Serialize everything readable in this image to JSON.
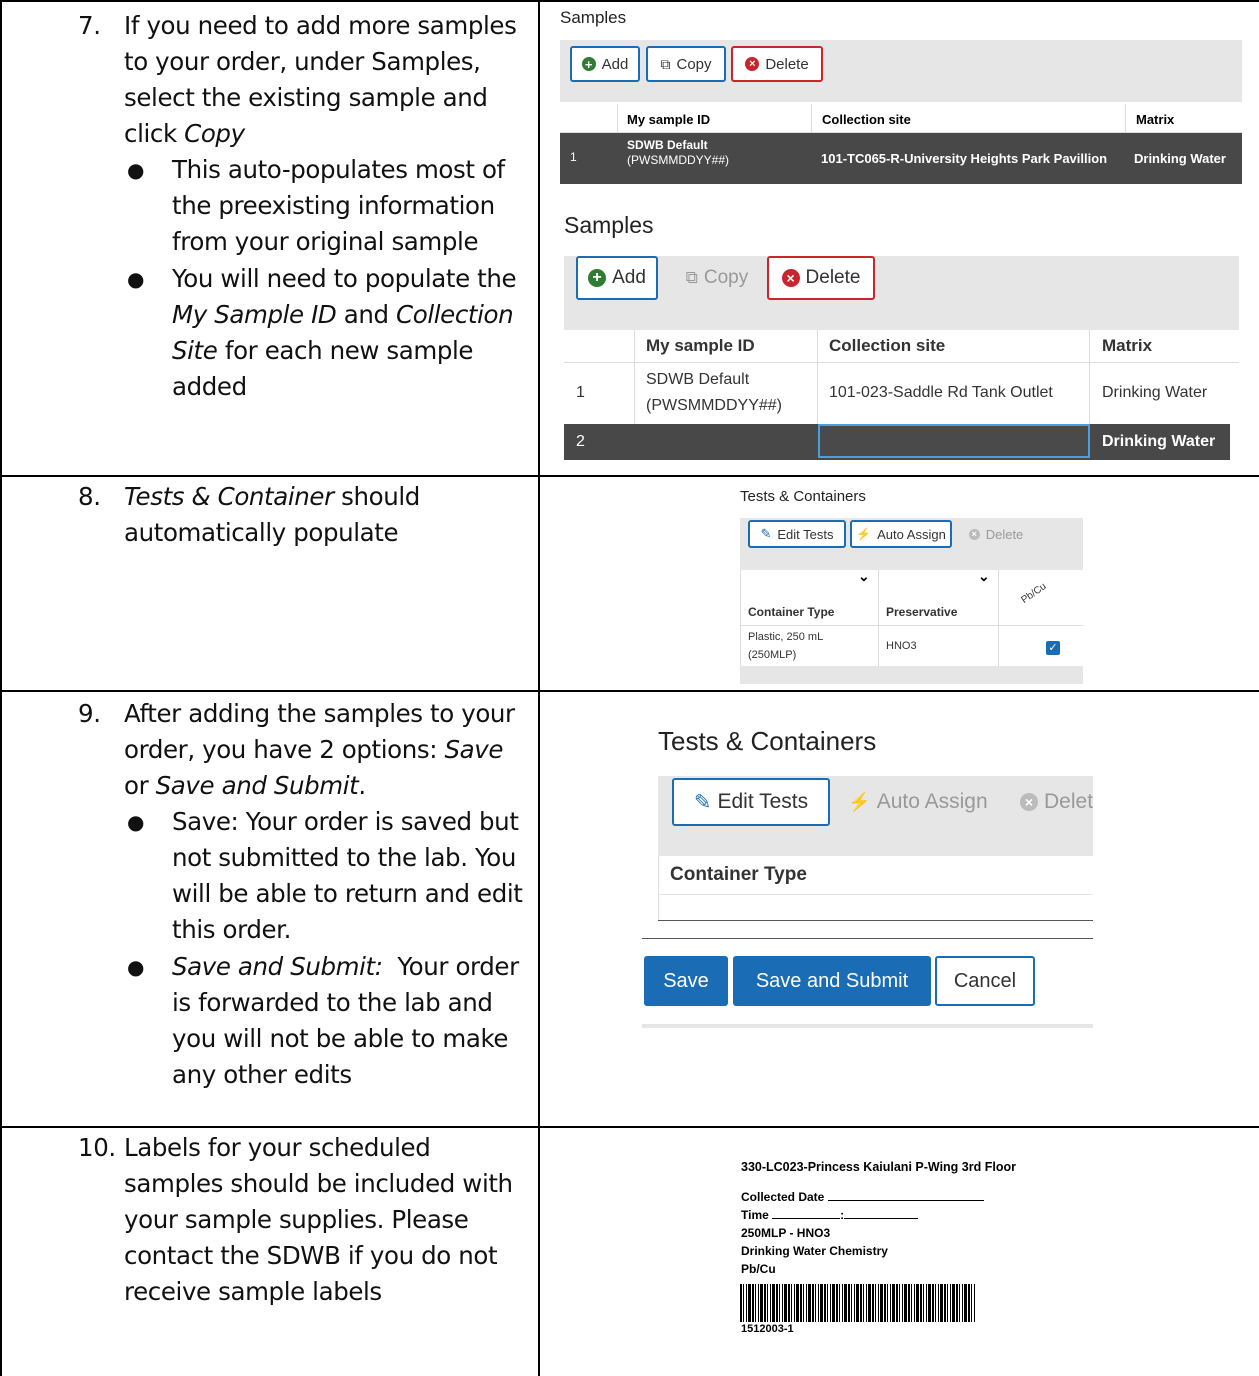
{
  "steps": {
    "s7": {
      "number": "7.",
      "l1": "If you need to add more samples",
      "l2": "to your order, under Samples,",
      "l3": "select the existing sample and",
      "l4a": "click ",
      "l4b": "Copy",
      "b1": "This auto-populates most of",
      "b1b": "the preexisting information",
      "b1c": "from your original sample",
      "b2": "You will need to populate the",
      "b2b1": "My Sample ID",
      "b2b2": " and ",
      "b2b3": "Collection",
      "b2c1": "Site",
      "b2c2": " for each new sample",
      "b2d": "added"
    },
    "s8": {
      "number": "8.",
      "l1a": "Tests & Container",
      "l1b": " should",
      "l2": "automatically populate"
    },
    "s9": {
      "number": "9.",
      "l1": "After adding the samples to your",
      "l2a": "order, you have 2 options: ",
      "l2b": "Save",
      "l3a": "or ",
      "l3b": "Save and Submit",
      "l3c": ".",
      "b1": "Save: Your order is saved but",
      "b1b": "not submitted to the lab. You",
      "b1c": "will be able to return and edit",
      "b1d": "this order.",
      "b2a": "Save and Submit:",
      "b2b": "  Your order",
      "b2c": "is forwarded to the lab and",
      "b2d": "you will not be able to make",
      "b2e": "any other edits"
    },
    "s10": {
      "number": "10.",
      "l1": "Labels for your scheduled",
      "l2": "samples should be included with",
      "l3": "your sample supplies. Please",
      "l4": "contact the SDWB if you do not",
      "l5": "receive sample labels"
    }
  },
  "shot1": {
    "title": "Samples",
    "add": "Add",
    "copy": "Copy",
    "delete": "Delete",
    "headers": [
      "My sample ID",
      "Collection site",
      "Matrix"
    ],
    "row": {
      "num": "1",
      "id1": "SDWB Default",
      "id2": "(PWSMMDDYY##)",
      "site": "101-TC065-R-University Heights Park Pavillion",
      "matrix": "Drinking Water"
    }
  },
  "shot2": {
    "title": "Samples",
    "add": "Add",
    "copy": "Copy",
    "delete": "Delete",
    "headers": [
      "My sample ID",
      "Collection site",
      "Matrix"
    ],
    "row1": {
      "num": "1",
      "id1": "SDWB Default",
      "id2": "(PWSMMDDYY##)",
      "site": "101-023-Saddle Rd Tank Outlet",
      "matrix": "Drinking Water"
    },
    "row2": {
      "num": "2",
      "id": "",
      "site": "",
      "matrix": "Drinking Water"
    }
  },
  "shot3": {
    "title": "Tests & Containers",
    "edit_tests": "Edit Tests",
    "auto_assign": "Auto Assign",
    "delete": "Delete",
    "headers": [
      "Container Type",
      "Preservative",
      "Pb/Cu"
    ],
    "row": {
      "type1": "Plastic, 250 mL",
      "type2": "(250MLP)",
      "preservative": "HNO3",
      "checked": true
    }
  },
  "shot4": {
    "title": "Tests & Containers",
    "edit_tests": "Edit Tests",
    "auto_assign": "Auto Assign",
    "delete": "Delet",
    "header": "Container Type",
    "save": "Save",
    "save_submit": "Save and Submit",
    "cancel": "Cancel"
  },
  "label": {
    "site": "330-LC023-Princess Kaiulani P-Wing 3rd Floor",
    "collected": "Collected Date",
    "time": "Time",
    "container": "250MLP - HNO3",
    "chemistry": "Drinking Water Chemistry",
    "analyte": "Pb/Cu",
    "barcode": "1512003-1"
  }
}
